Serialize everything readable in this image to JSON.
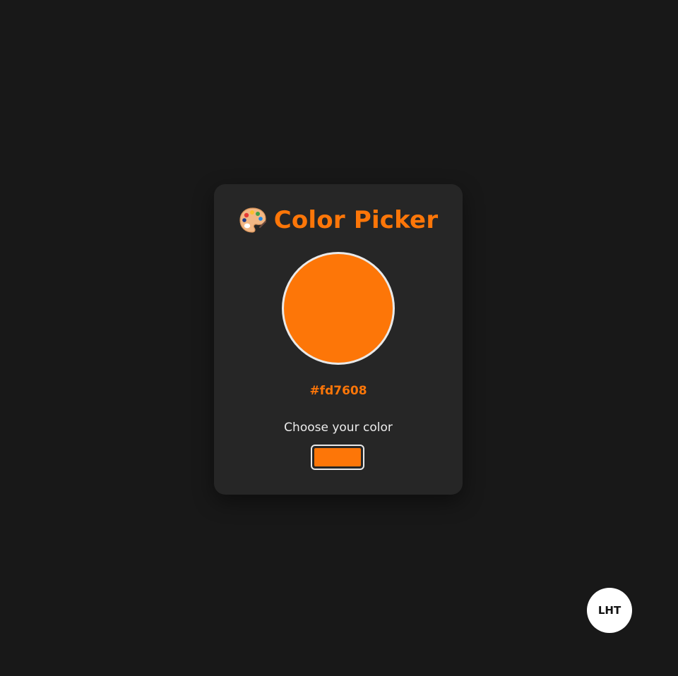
{
  "app": {
    "title": "Color Picker",
    "title_icon": "palette-icon"
  },
  "picker": {
    "hex": "#fd7608",
    "label": "Choose your color",
    "current_color": "#fd7608"
  },
  "avatar": {
    "initials": "LHT"
  },
  "colors": {
    "background": "#181818",
    "card": "#262626",
    "accent": "#fd7608",
    "border": "#e9e9e9",
    "text": "#ececec"
  }
}
